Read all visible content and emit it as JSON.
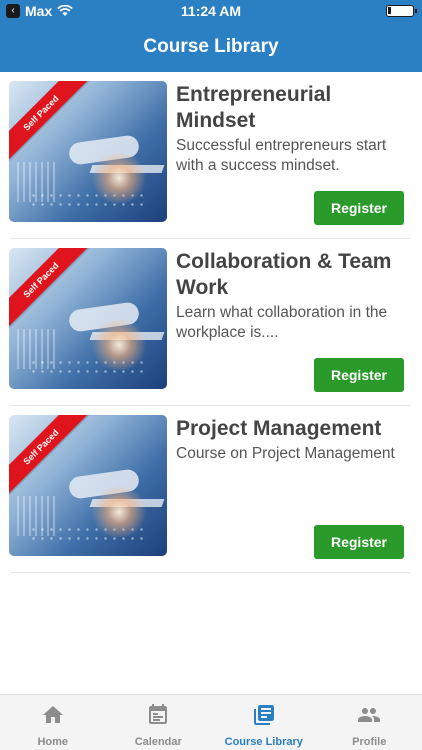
{
  "status_bar": {
    "carrier": "Max",
    "time": "11:24 AM",
    "battery_level": 0.15
  },
  "header": {
    "title": "Course Library"
  },
  "courses": [
    {
      "title": "Entrepreneurial Mindset",
      "description": "Successful entrepreneurs start with a success mindset.",
      "ribbon": "Self Paced",
      "register_label": "Register"
    },
    {
      "title": "Collaboration & Team Work",
      "description": "Learn what collaboration in the workplace is....",
      "ribbon": "Self Paced",
      "register_label": "Register"
    },
    {
      "title": "Project Management",
      "description": "Course on Project Management",
      "ribbon": "Self Paced",
      "register_label": "Register"
    }
  ],
  "tab_bar": {
    "tabs": [
      {
        "label": "Home",
        "icon": "home-icon",
        "active": false
      },
      {
        "label": "Calendar",
        "icon": "calendar-icon",
        "active": false
      },
      {
        "label": "Course Library",
        "icon": "library-icon",
        "active": true
      },
      {
        "label": "Profile",
        "icon": "people-icon",
        "active": false
      }
    ]
  },
  "colors": {
    "primary": "#2b7fc3",
    "register_button": "#2a9a2a",
    "ribbon": "#e0141c",
    "tab_inactive": "#8c8c8c"
  }
}
